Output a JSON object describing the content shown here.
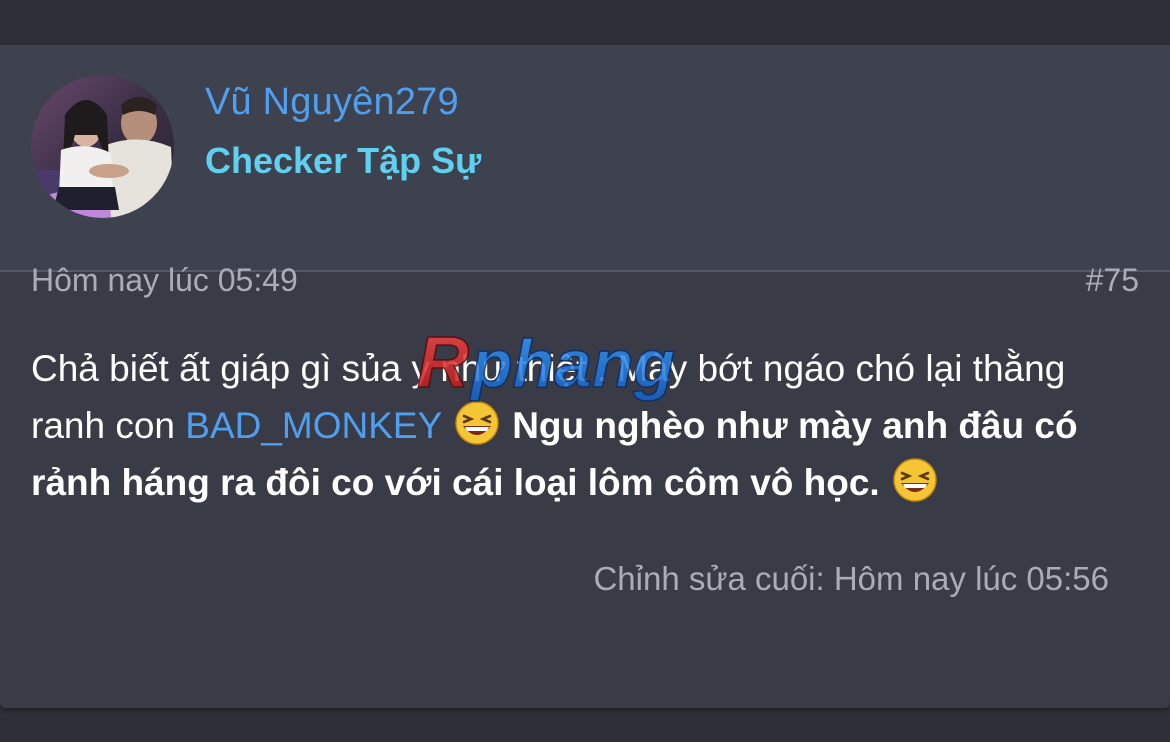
{
  "user": {
    "name": "Vũ Nguyên279",
    "title": "Checker Tập Sự"
  },
  "post": {
    "date": "Hôm nay lúc 05:49",
    "number": "#75",
    "text_1": "Chả biết ất giáp gì sủa y như thiệt . Mày bớt ngáo chó lại thằng ranh con ",
    "mention": "BAD_MONKEY",
    "text_2": " Ngu nghèo như mày anh đâu có rảnh háng ra đôi co với cái loại lôm côm vô học.",
    "last_edit": "Chỉnh sửa cuối: Hôm nay lúc 05:56"
  },
  "watermark": {
    "text": "Rphang"
  },
  "icons": {
    "emoji": "laughing-emoji-icon",
    "avatar": "user-avatar-photo"
  },
  "colors": {
    "background": "#2d3039",
    "card": "#393c47",
    "header": "#3e424e",
    "link": "#4f9ff0",
    "title": "#5fd0f0",
    "muted": "#a9adb7"
  }
}
